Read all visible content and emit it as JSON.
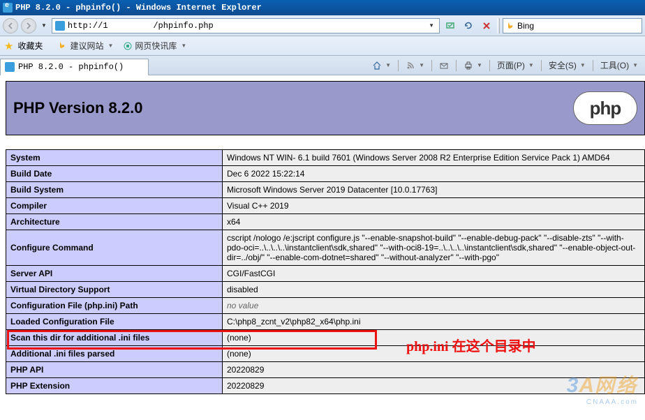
{
  "window": {
    "title": "PHP 8.2.0 - phpinfo() - Windows Internet Explorer"
  },
  "address": {
    "url": "http://1         /phpinfo.php"
  },
  "search": {
    "placeholder": "",
    "value": "Bing"
  },
  "favbar": {
    "label": "收藏夹",
    "links": [
      {
        "text": "建议网站"
      },
      {
        "text": "网页快讯库"
      }
    ]
  },
  "tab": {
    "title": "PHP 8.2.0 - phpinfo()"
  },
  "cmds": {
    "page": "页面(P)",
    "safety": "安全(S)",
    "tools": "工具(O)"
  },
  "phpinfo": {
    "heading": "PHP Version 8.2.0",
    "logo": "php",
    "rows": [
      {
        "k": "System",
        "v": "Windows NT WIN-                      6.1 build 7601 (Windows Server 2008 R2 Enterprise Edition Service Pack 1) AMD64"
      },
      {
        "k": "Build Date",
        "v": "Dec 6 2022 15:22:14"
      },
      {
        "k": "Build System",
        "v": "Microsoft Windows Server 2019 Datacenter [10.0.17763]"
      },
      {
        "k": "Compiler",
        "v": "Visual C++ 2019"
      },
      {
        "k": "Architecture",
        "v": "x64"
      },
      {
        "k": "Configure Command",
        "v": "cscript /nologo /e:jscript configure.js \"--enable-snapshot-build\" \"--enable-debug-pack\" \"--disable-zts\" \"--with-pdo-oci=..\\..\\..\\..\\instantclient\\sdk,shared\" \"--with-oci8-19=..\\..\\..\\..\\instantclient\\sdk,shared\" \"--enable-object-out-dir=../obj/\" \"--enable-com-dotnet=shared\" \"--without-analyzer\" \"--with-pgo\""
      },
      {
        "k": "Server API",
        "v": "CGI/FastCGI"
      },
      {
        "k": "Virtual Directory Support",
        "v": "disabled"
      },
      {
        "k": "Configuration File (php.ini) Path",
        "v": "no value",
        "novalue": true
      },
      {
        "k": "Loaded Configuration File",
        "v": "C:\\php8_zcnt_v2\\php82_x64\\php.ini"
      },
      {
        "k": "Scan this dir for additional .ini files",
        "v": "(none)"
      },
      {
        "k": "Additional .ini files parsed",
        "v": "(none)"
      },
      {
        "k": "PHP API",
        "v": "20220829"
      },
      {
        "k": "PHP Extension",
        "v": "20220829"
      }
    ]
  },
  "annotation": {
    "text": "php.ini 在这个目录中"
  },
  "watermark": {
    "brand": "3A网络",
    "sub": "CNAAA.com"
  }
}
